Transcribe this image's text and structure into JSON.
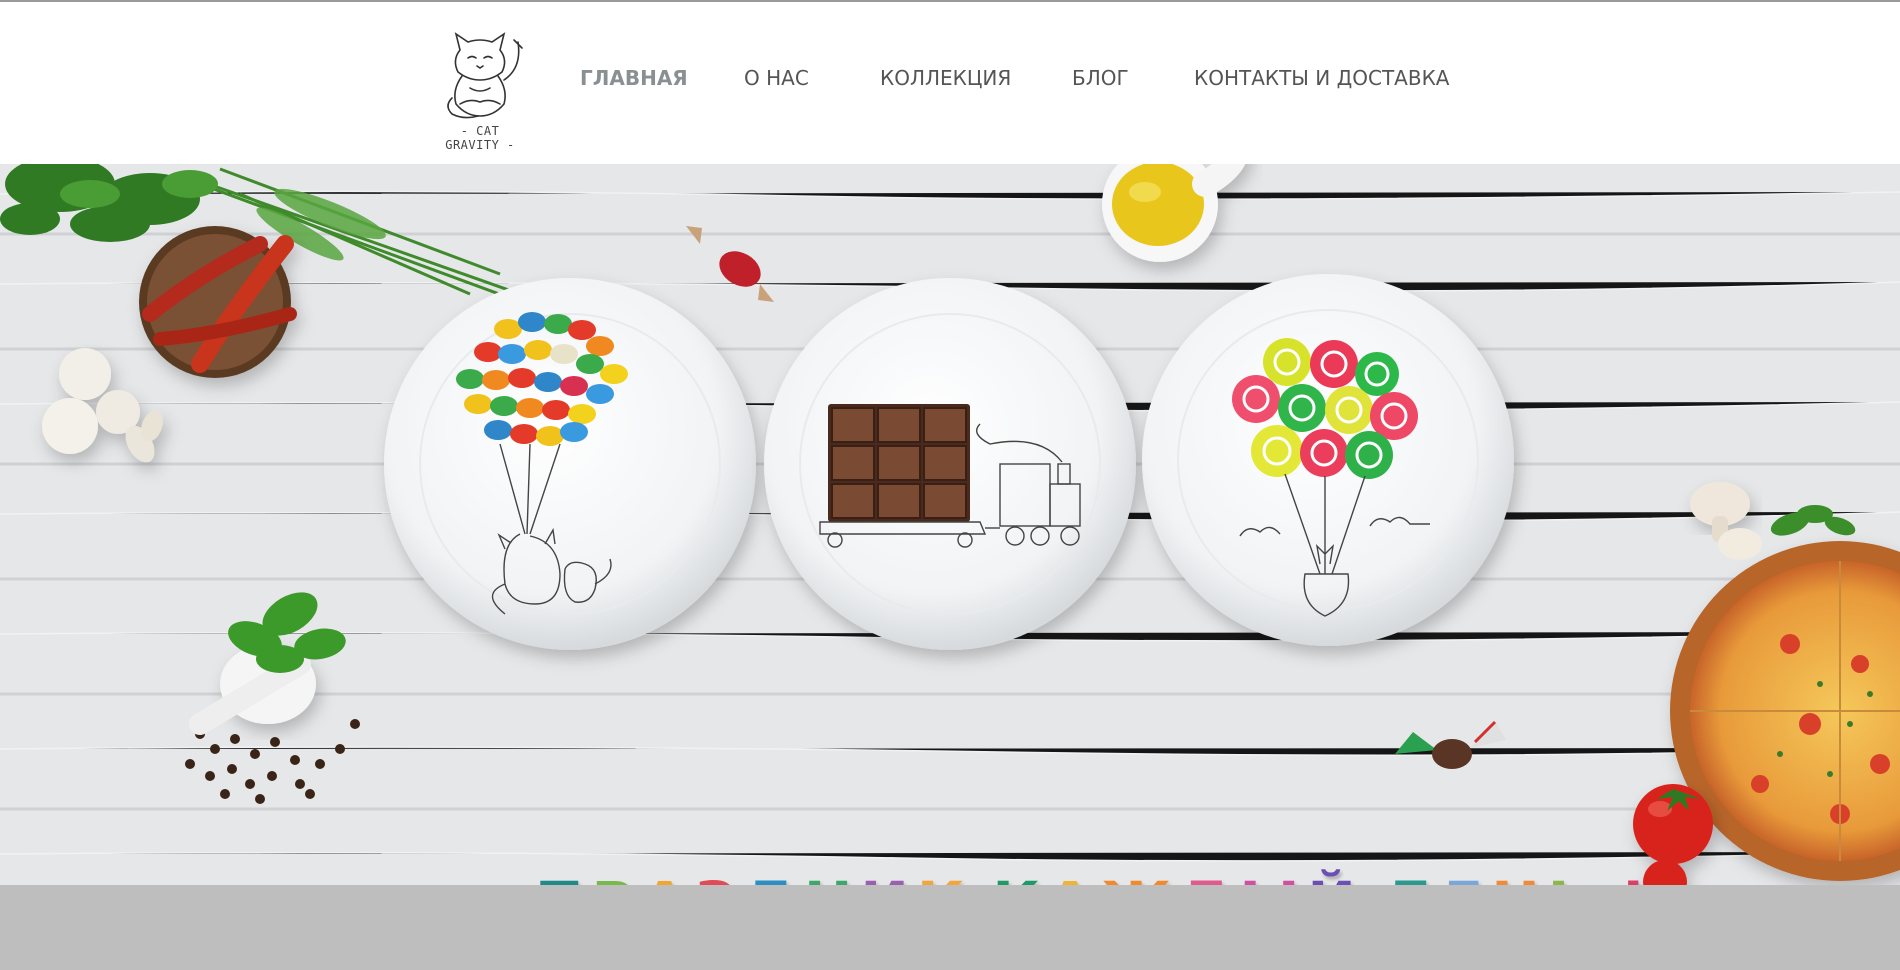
{
  "brand": {
    "logo_text": "- CAT GRAVITY -"
  },
  "nav": {
    "items": [
      {
        "label": "ГЛАВНАЯ",
        "active": true
      },
      {
        "label": "О НАС",
        "active": false
      },
      {
        "label": "КОЛЛЕКЦИЯ",
        "active": false
      },
      {
        "label": "БЛОГ",
        "active": false
      },
      {
        "label": "КОНТАКТЫ И ДОСТАВКА",
        "active": false
      }
    ]
  },
  "hero": {
    "slogan_letters": [
      {
        "ch": "П",
        "color": "#1f8a8a"
      },
      {
        "ch": "Р",
        "color": "#79b84a"
      },
      {
        "ch": "А",
        "color": "#f1a72e"
      },
      {
        "ch": "З",
        "color": "#e04b55"
      },
      {
        "ch": "Д",
        "color": "#2b8fc4"
      },
      {
        "ch": "Н",
        "color": "#3ea86a"
      },
      {
        "ch": "И",
        "color": "#9b5fb0"
      },
      {
        "ch": "К",
        "color": "#f2a53a"
      },
      {
        "ch": " ",
        "color": "#000000"
      },
      {
        "ch": "К",
        "color": "#1e9a6a"
      },
      {
        "ch": "А",
        "color": "#eeb534"
      },
      {
        "ch": "Ж",
        "color": "#f08a2c"
      },
      {
        "ch": "Д",
        "color": "#e15a8c"
      },
      {
        "ch": "Ы",
        "color": "#cf4fa0"
      },
      {
        "ch": "Й",
        "color": "#6b4fb3"
      },
      {
        "ch": " ",
        "color": "#000000"
      },
      {
        "ch": "Д",
        "color": "#2a9a8e"
      },
      {
        "ch": "Е",
        "color": "#7aa6d8"
      },
      {
        "ch": "Н",
        "color": "#f08a36"
      },
      {
        "ch": "Ь",
        "color": "#8ab84a"
      },
      {
        "ch": " ",
        "color": "#000000"
      },
      {
        "ch": "!",
        "color": "#d84064"
      }
    ]
  },
  "colors": {
    "nav_text": "#555555",
    "nav_active": "#8a9092",
    "wood": "#e7e8ea",
    "bottom_bar": "#bebebe"
  }
}
